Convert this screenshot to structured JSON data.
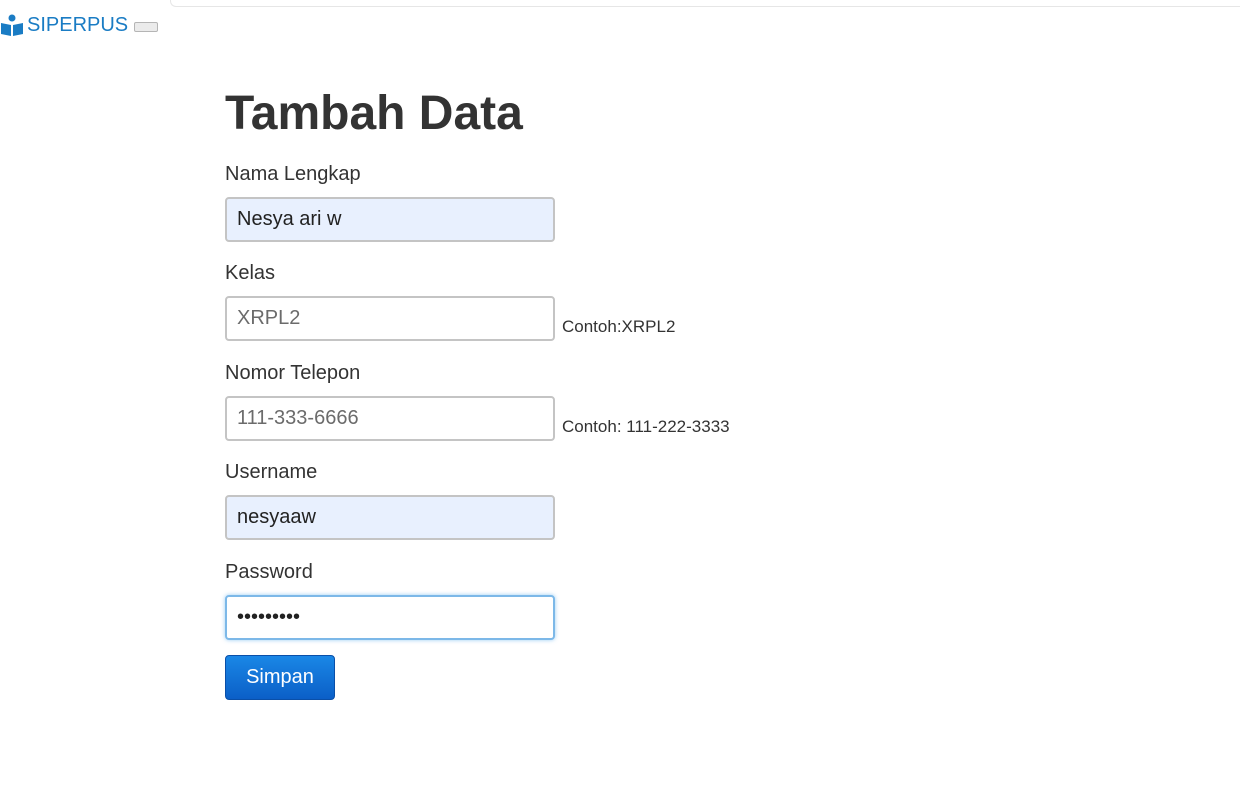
{
  "navbar": {
    "brand_label": "SIPERPUS",
    "brand_icon": "reader-book-icon",
    "accent_color": "#1a7cc4"
  },
  "page": {
    "title": "Tambah Data"
  },
  "form": {
    "nama": {
      "label": "Nama Lengkap",
      "value": "Nesya ari w"
    },
    "kelas": {
      "label": "Kelas",
      "placeholder": "XRPL2",
      "hint": "Contoh:XRPL2"
    },
    "telepon": {
      "label": "Nomor Telepon",
      "placeholder": "111-333-6666",
      "hint": "Contoh: 111-222-3333"
    },
    "username": {
      "label": "Username",
      "value": "nesyaaw"
    },
    "password": {
      "label": "Password",
      "value": "•••••••••"
    },
    "submit_label": "Simpan",
    "submit_color": "#0b6ad6"
  }
}
